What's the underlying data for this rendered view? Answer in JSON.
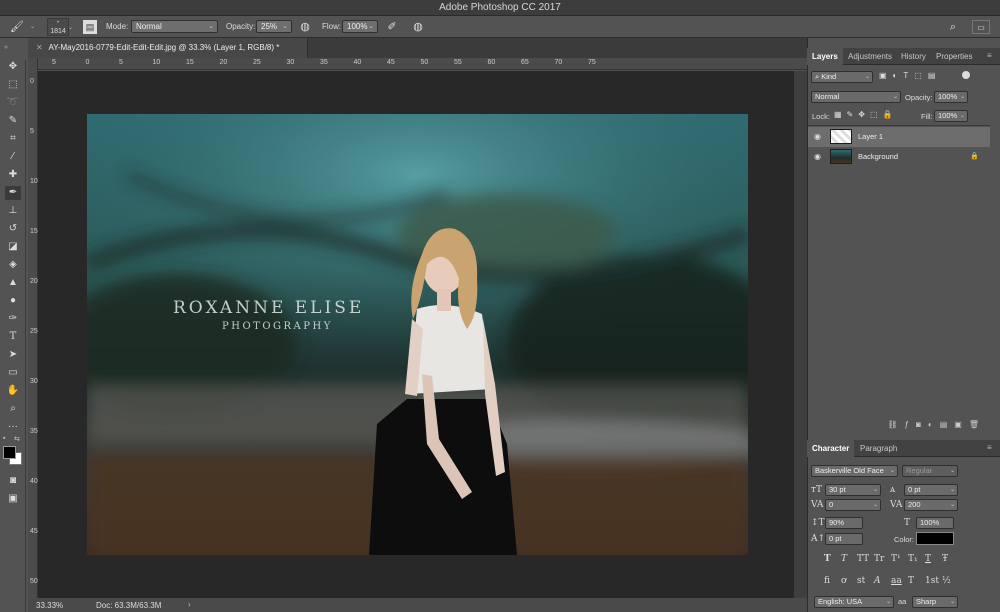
{
  "window": {
    "title": "Adobe Photoshop CC 2017"
  },
  "options_bar": {
    "brush_size": "1814",
    "mode_label": "Mode:",
    "mode_value": "Normal",
    "opacity_label": "Opacity:",
    "opacity_value": "25%",
    "flow_label": "Flow:",
    "flow_value": "100%"
  },
  "document": {
    "tab_title": "AY-May2016-0779-Edit-Edit-Edit.jpg @ 33.3% (Layer 1, RGB/8) *",
    "watermark_line1": "ROXANNE ELISE",
    "watermark_line2": "PHOTOGRAPHY"
  },
  "ruler": {
    "h_ticks": [
      "5",
      "0",
      "5",
      "10",
      "15",
      "20",
      "25",
      "30",
      "35",
      "40",
      "45",
      "50",
      "55",
      "60",
      "65",
      "70",
      "75"
    ],
    "v_ticks": [
      "0",
      "5",
      "10",
      "15",
      "20",
      "25",
      "30",
      "35",
      "40",
      "45",
      "50"
    ]
  },
  "status": {
    "zoom": "33.33%",
    "doc_size": "Doc: 63.3M/63.3M"
  },
  "layers_panel": {
    "tabs": [
      "Layers",
      "Adjustments",
      "History",
      "Properties"
    ],
    "filter_label": "Kind",
    "blend_mode": "Normal",
    "opacity_label": "Opacity:",
    "opacity_value": "100%",
    "lock_label": "Lock:",
    "fill_label": "Fill:",
    "fill_value": "100%",
    "layers": [
      {
        "name": "Layer 1"
      },
      {
        "name": "Background"
      }
    ]
  },
  "character_panel": {
    "tabs": [
      "Character",
      "Paragraph"
    ],
    "font_family": "Baskerville Old Face",
    "font_style": "Regular",
    "font_size": "30 pt",
    "leading": "0 pt",
    "kerning": "0",
    "tracking": "200",
    "vertical_scale": "90%",
    "horizontal_scale": "100%",
    "baseline_shift": "0 pt",
    "color_label": "Color:",
    "language": "English: USA",
    "aa_label": "a",
    "antialias": "Sharp",
    "style_buttons_row1": [
      "T",
      "T",
      "TT",
      "Tr",
      "T¹",
      "T₁",
      "T",
      "Ŧ"
    ],
    "style_buttons_row2": [
      "fi",
      "ơ",
      "st",
      "A",
      "aa",
      "T",
      "1st",
      "½"
    ]
  },
  "colors": {
    "panel_bg": "#535353",
    "canvas_bg": "#282828",
    "foreground": "#000000",
    "background": "#ffffff"
  }
}
